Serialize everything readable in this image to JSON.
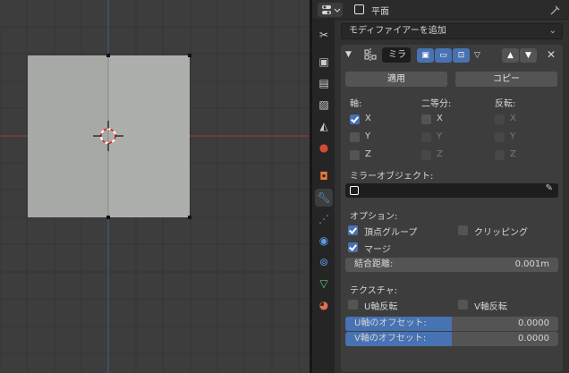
{
  "header": {
    "object_name": "平面",
    "pin_icon": "pin-icon",
    "editor_type_icon": "properties-editor-icon"
  },
  "tabs": [
    {
      "name": "tool-tab",
      "icon": "wrench-screwdriver-icon"
    },
    {
      "name": "render-tab",
      "icon": "camera-back-icon"
    },
    {
      "name": "output-tab",
      "icon": "printer-icon"
    },
    {
      "name": "view-layer-tab",
      "icon": "image-stack-icon"
    },
    {
      "name": "scene-tab",
      "icon": "cone-sphere-icon"
    },
    {
      "name": "world-tab",
      "icon": "globe-icon"
    },
    {
      "name": "object-tab",
      "icon": "object-square-icon"
    },
    {
      "name": "modifier-tab",
      "icon": "wrench-icon"
    },
    {
      "name": "particles-tab",
      "icon": "particles-icon"
    },
    {
      "name": "physics-tab",
      "icon": "physics-icon"
    },
    {
      "name": "constraints-tab",
      "icon": "constraint-icon"
    },
    {
      "name": "data-tab",
      "icon": "mesh-triangle-icon"
    },
    {
      "name": "material-tab",
      "icon": "material-sphere-icon"
    }
  ],
  "add_modifier": {
    "label": "モディファイアーを追加"
  },
  "modifier": {
    "name": "ミラ",
    "apply_label": "適用",
    "copy_label": "コピー",
    "axis_header": "軸:",
    "bisect_header": "二等分:",
    "flip_header": "反転:",
    "axes": [
      {
        "label": "X",
        "axis": true,
        "bisect": false,
        "flip": false
      },
      {
        "label": "Y",
        "axis": false,
        "bisect": false,
        "flip": false
      },
      {
        "label": "Z",
        "axis": false,
        "bisect": false,
        "flip": false
      }
    ],
    "mirror_object_label": "ミラーオブジェクト:",
    "mirror_object_value": "",
    "options_header": "オプション:",
    "vertex_groups_label": "頂点グループ",
    "vertex_groups_on": true,
    "clipping_label": "クリッピング",
    "clipping_on": false,
    "merge_label": "マージ",
    "merge_on": true,
    "merge_distance_label": "結合距離:",
    "merge_distance_value": "0.001m",
    "textures_header": "テクスチャ:",
    "flip_u_label": "U軸反転",
    "flip_u_on": false,
    "flip_v_label": "V軸反転",
    "flip_v_on": false,
    "u_offset_label": "U軸のオフセット:",
    "u_offset_value": "0.0000",
    "v_offset_label": "V軸のオフセット:",
    "v_offset_value": "0.0000"
  },
  "colors": {
    "accent": "#4772b3",
    "x_axis": "#9a3a3a",
    "y_axis": "#3a5a8a"
  }
}
